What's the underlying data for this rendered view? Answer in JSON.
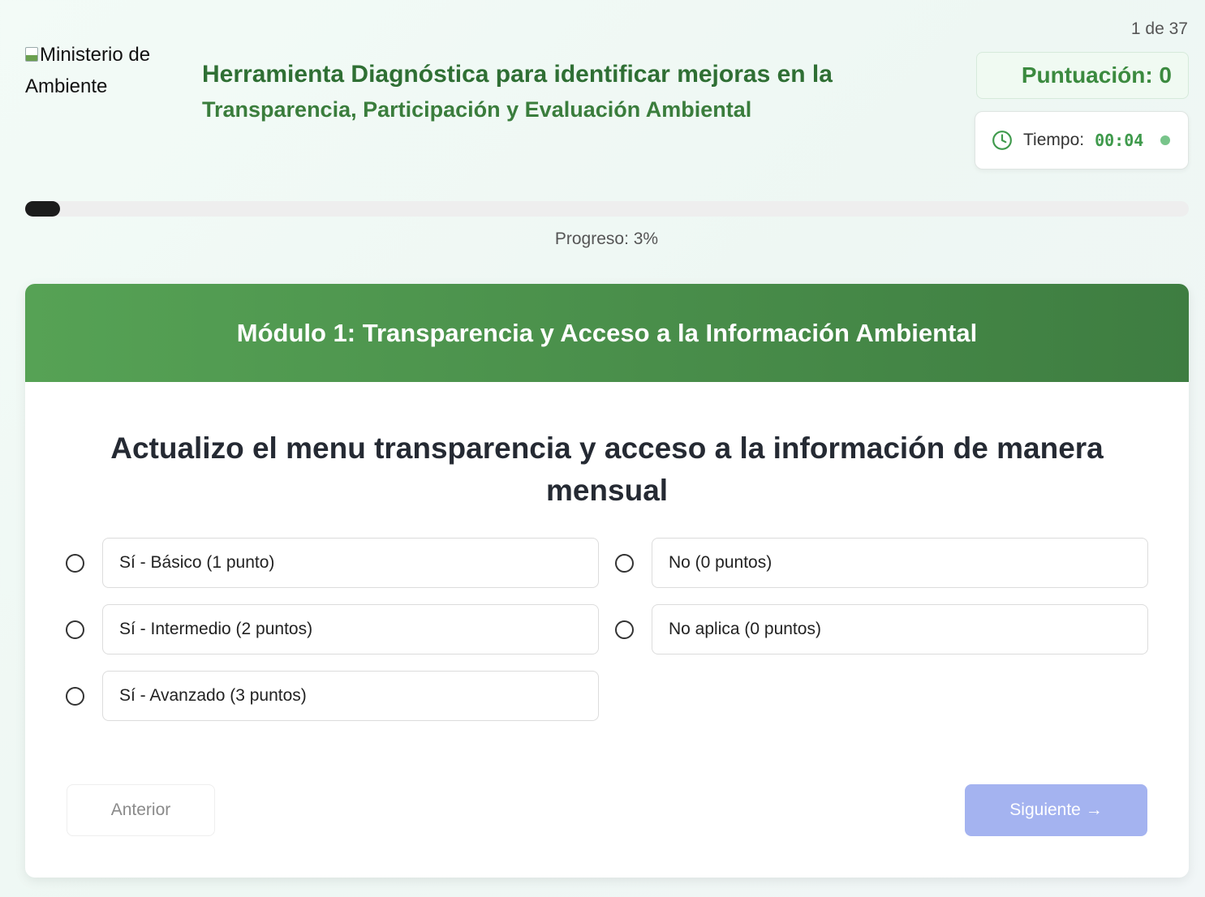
{
  "header": {
    "counter": "1 de 37",
    "logo_alt": "Ministerio de Ambiente",
    "title_line1": "Herramienta Diagnóstica para identificar mejoras en la",
    "title_line2": "Transparencia, Participación y Evaluación Ambiental",
    "score_label": "Puntuación: 0",
    "timer_label": "Tiempo:",
    "timer_value": "00:04",
    "clock_icon": "clock-icon"
  },
  "progress": {
    "percent": 3,
    "label": "Progreso: 3%"
  },
  "module": {
    "title": "Módulo 1: Transparencia y Acceso a la Información Ambiental"
  },
  "question": {
    "text": "Actualizo el menu transparencia y acceso a la información de manera mensual",
    "options": [
      {
        "label": "Sí - Básico (1 punto)",
        "selected": false
      },
      {
        "label": "No (0 puntos)",
        "selected": false
      },
      {
        "label": "Sí - Intermedio (2 puntos)",
        "selected": false
      },
      {
        "label": "No aplica (0 puntos)",
        "selected": false
      },
      {
        "label": "Sí - Avanzado (3 puntos)",
        "selected": false
      }
    ]
  },
  "nav": {
    "prev_label": "Anterior",
    "next_label": "Siguiente →"
  },
  "colors": {
    "brand_green": "#3a7d3c",
    "header_gradient_start": "#56a255",
    "header_gradient_end": "#3e7d41",
    "next_button": "#a4b3f0"
  }
}
